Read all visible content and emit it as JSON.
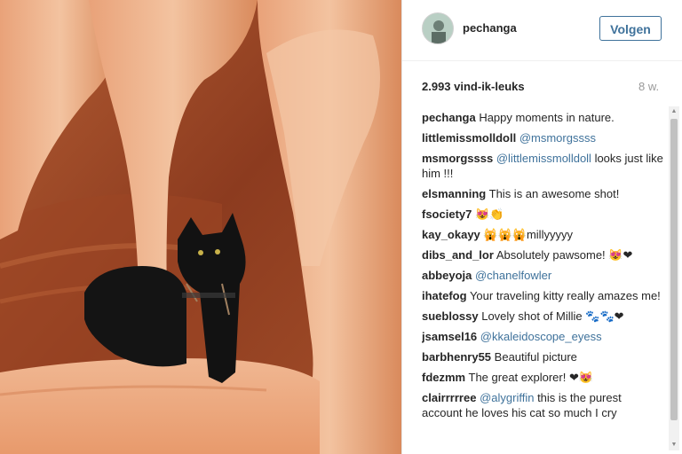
{
  "post": {
    "username": "pechanga",
    "follow_label": "Volgen",
    "likes": "2.993 vind-ik-leuks",
    "age": "8 w."
  },
  "comments": [
    {
      "user": "pechanga",
      "parts": [
        {
          "t": "Happy moments in nature."
        }
      ]
    },
    {
      "user": "littlemissmolldoll",
      "parts": [
        {
          "t": "@msmorgssss",
          "m": true
        }
      ]
    },
    {
      "user": "msmorgssss",
      "parts": [
        {
          "t": "@littlemissmolldoll",
          "m": true
        },
        {
          "t": " looks just like him !!!"
        }
      ]
    },
    {
      "user": "elsmanning",
      "parts": [
        {
          "t": "This is an awesome shot!"
        }
      ]
    },
    {
      "user": "fsociety7",
      "parts": [
        {
          "t": "😻👏"
        }
      ]
    },
    {
      "user": "kay_okayy",
      "parts": [
        {
          "t": "🙀🙀🙀millyyyyy"
        }
      ]
    },
    {
      "user": "dibs_and_lor",
      "parts": [
        {
          "t": "Absolutely pawsome! 😻❤"
        }
      ]
    },
    {
      "user": "abbeyoja",
      "parts": [
        {
          "t": "@chanelfowler",
          "m": true
        }
      ]
    },
    {
      "user": "ihatefog",
      "parts": [
        {
          "t": "Your traveling kitty really amazes me!"
        }
      ]
    },
    {
      "user": "sueblossy",
      "parts": [
        {
          "t": "Lovely shot of Millie 🐾🐾❤"
        }
      ]
    },
    {
      "user": "jsamsel16",
      "parts": [
        {
          "t": "@kkaleidoscope_eyess",
          "m": true
        }
      ]
    },
    {
      "user": "barbhenry55",
      "parts": [
        {
          "t": "Beautiful picture"
        }
      ]
    },
    {
      "user": "fdezmm",
      "parts": [
        {
          "t": "The great explorer! ❤😻"
        }
      ]
    },
    {
      "user": "clairrrrree",
      "parts": [
        {
          "t": "@alygriffin",
          "m": true
        },
        {
          "t": " this is the purest account he loves his cat so much I cry"
        }
      ]
    }
  ],
  "colors": {
    "link": "#3f729b",
    "text": "#262626",
    "muted": "#999999"
  },
  "icons": {
    "scroll_up": "triangle-up-icon",
    "scroll_down": "triangle-down-icon"
  }
}
